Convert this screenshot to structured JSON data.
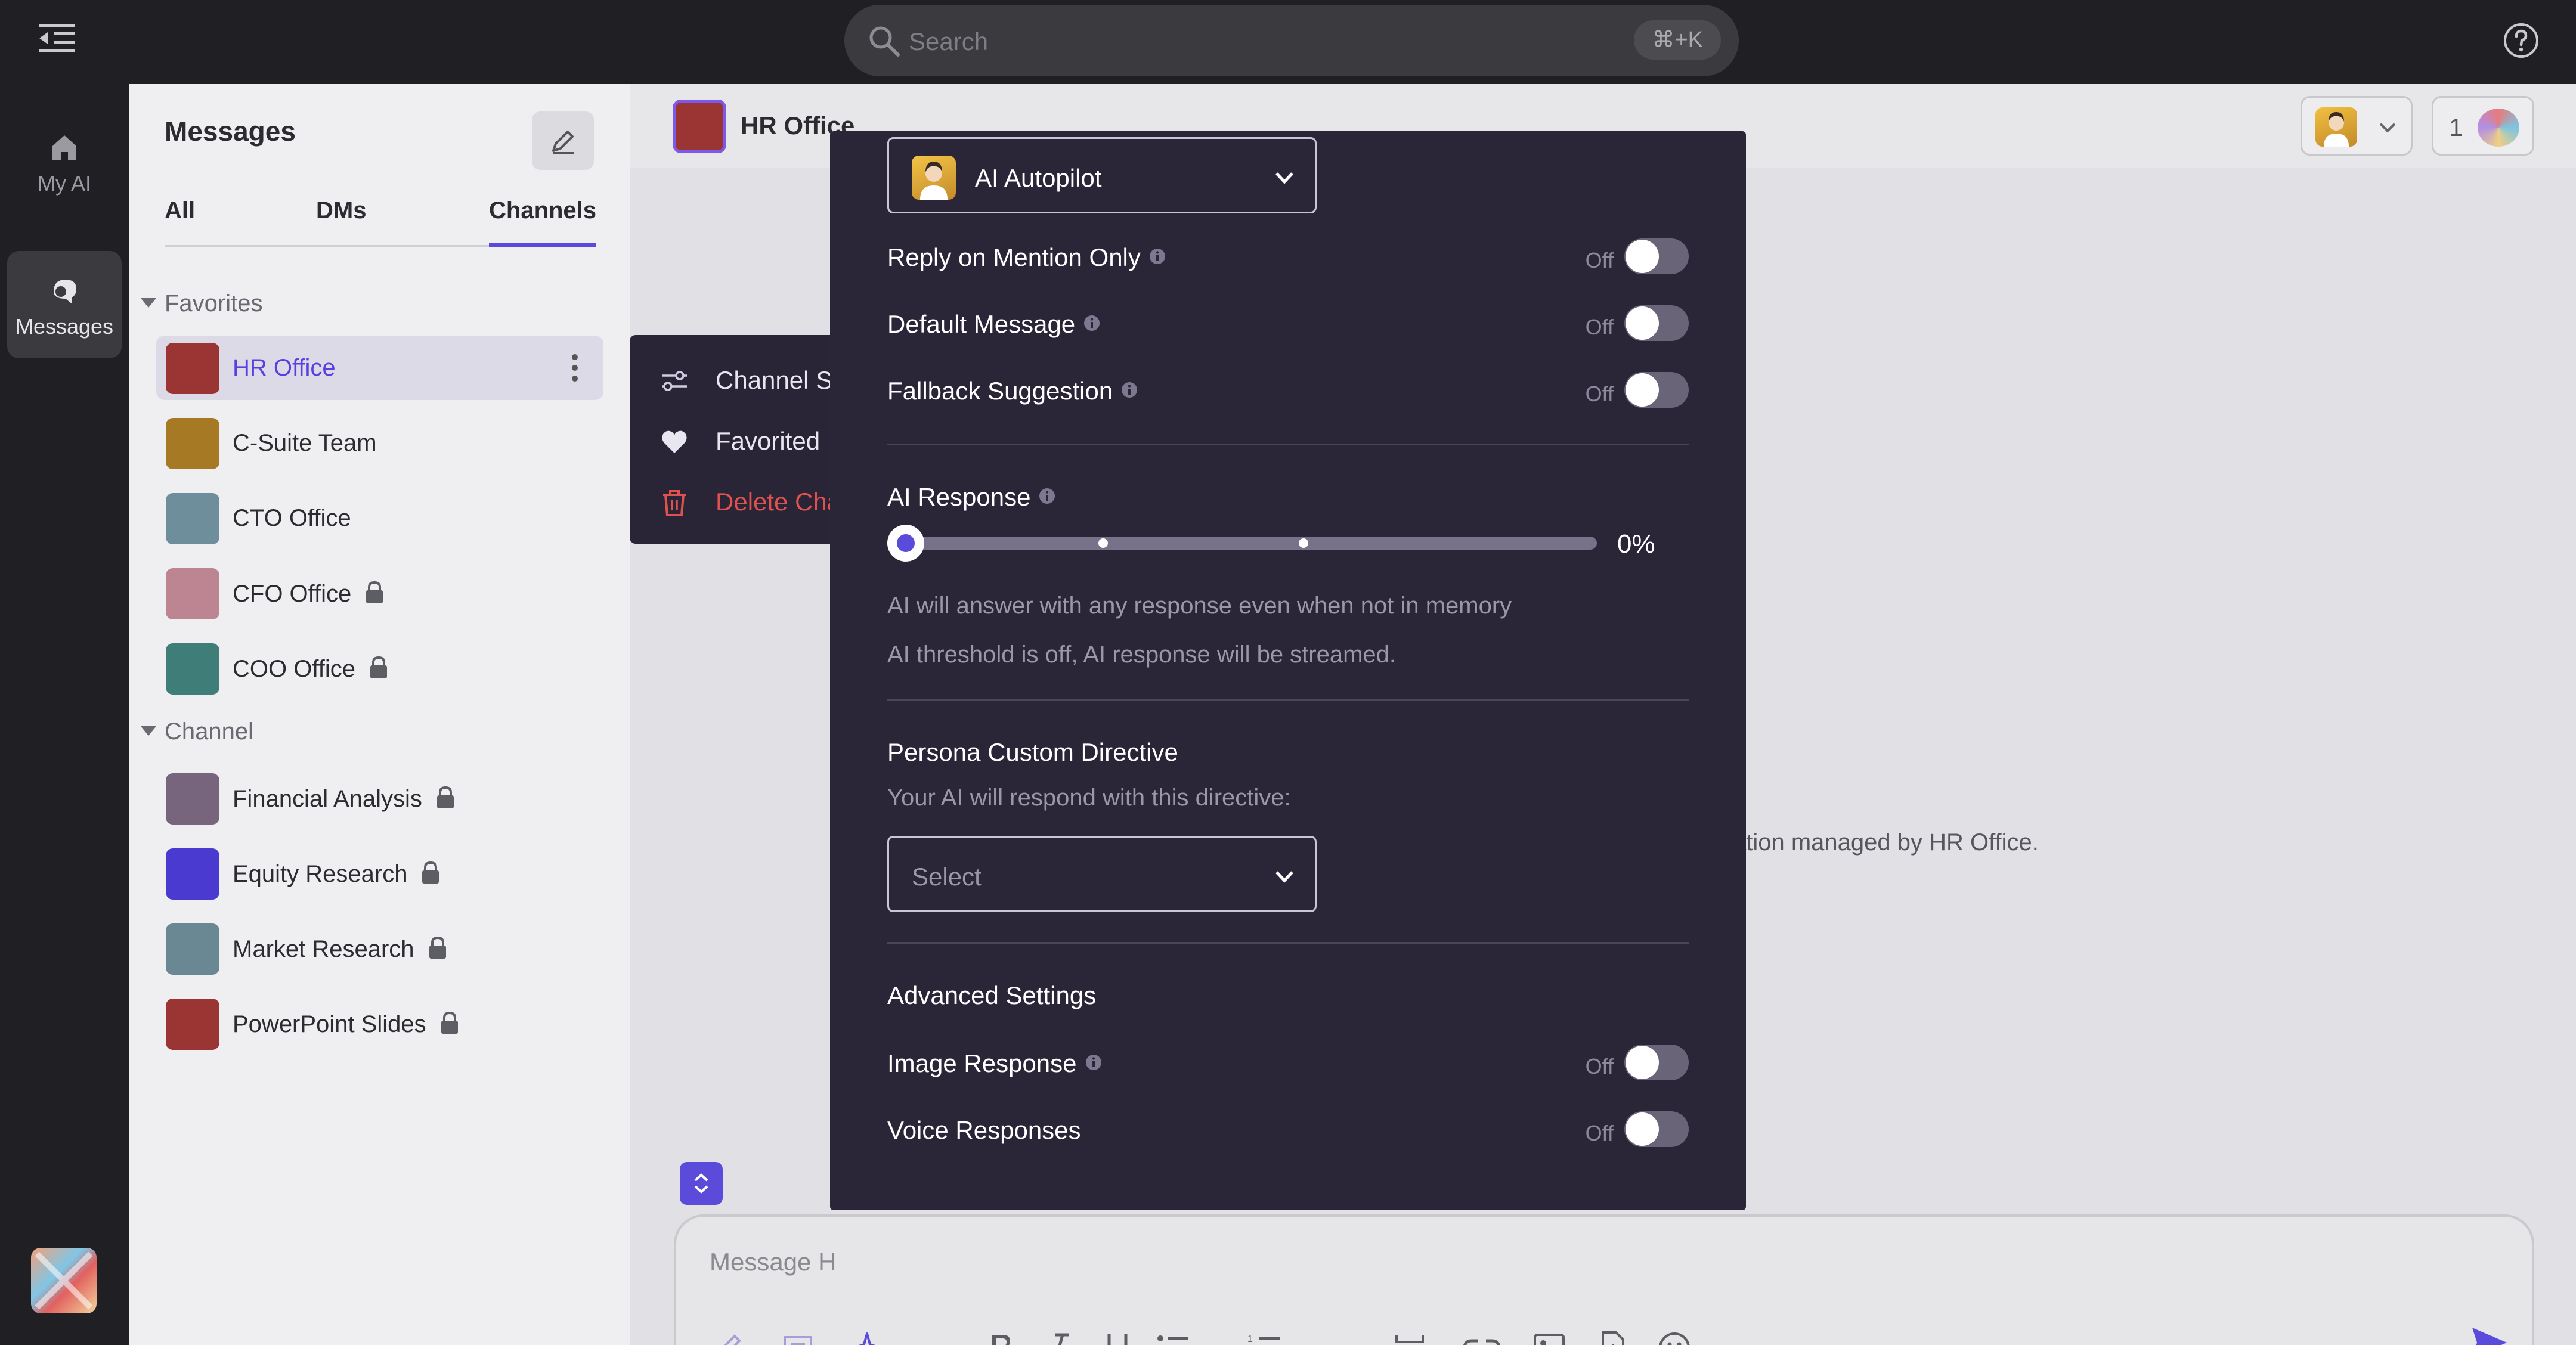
{
  "topbar": {
    "search_placeholder": "Search",
    "search_shortcut": "⌘+K",
    "icons": {
      "menu": "menu-collapse-icon",
      "search": "search-icon",
      "help": "help-circle-icon"
    }
  },
  "rail": {
    "items": [
      {
        "label": "My AI",
        "icon": "home-icon",
        "active": false
      },
      {
        "label": "Messages",
        "icon": "messages-icon",
        "active": true
      }
    ]
  },
  "sidebar": {
    "title": "Messages",
    "tabs": [
      {
        "label": "All",
        "active": false
      },
      {
        "label": "DMs",
        "active": false
      },
      {
        "label": "Channels",
        "active": true
      }
    ],
    "favorites_label": "Favorites",
    "channel_label": "Channel",
    "favorites": [
      {
        "name": "HR Office",
        "color": "#9b3533",
        "locked": false,
        "selected": true
      },
      {
        "name": "C-Suite Team",
        "color": "#a67a25",
        "locked": false
      },
      {
        "name": "CTO Office",
        "color": "#6e8e9c",
        "locked": false
      },
      {
        "name": "CFO Office",
        "color": "#bd8591",
        "locked": true
      },
      {
        "name": "COO Office",
        "color": "#3f7d78",
        "locked": true
      }
    ],
    "channels": [
      {
        "name": "Financial Analysis",
        "color": "#76657d",
        "locked": true
      },
      {
        "name": "Equity Research",
        "color": "#4a3ad0",
        "locked": true
      },
      {
        "name": "Market Research",
        "color": "#698893",
        "locked": true
      },
      {
        "name": "PowerPoint Slides",
        "color": "#9b3533",
        "locked": true
      }
    ]
  },
  "main": {
    "channel_name": "HR Office",
    "members_count": "1",
    "info_text": "ation managed by HR Office.",
    "composer_placeholder": "Message H"
  },
  "context_menu": {
    "items": [
      {
        "label": "Channel Se",
        "icon": "sliders-icon"
      },
      {
        "label": "Favorited",
        "icon": "heart-icon"
      },
      {
        "label": "Delete Cha",
        "icon": "trash-icon",
        "danger": true
      }
    ]
  },
  "autopilot": {
    "persona": "AI Autopilot",
    "toggles_top": [
      {
        "label": "Reply on Mention Only",
        "state": "Off"
      },
      {
        "label": "Default Message",
        "state": "Off"
      },
      {
        "label": "Fallback Suggestion",
        "state": "Off"
      }
    ],
    "ai_response_label": "AI Response",
    "ai_response_value": "0%",
    "ai_response_percent": 0,
    "ai_response_note_1": "AI will answer with any response even when not in memory",
    "ai_response_note_2": "AI threshold is off, AI response will be streamed.",
    "directive_title": "Persona Custom Directive",
    "directive_subtitle": "Your AI will respond with this directive:",
    "directive_placeholder": "Select",
    "advanced_title": "Advanced Settings",
    "toggles_advanced": [
      {
        "label": "Image Response",
        "state": "Off",
        "info": true
      },
      {
        "label": "Voice Responses",
        "state": "Off",
        "info": false
      }
    ]
  },
  "colors": {
    "accent": "#5b4bdb",
    "panel_bg": "#2b2538",
    "danger": "#e1514e"
  }
}
